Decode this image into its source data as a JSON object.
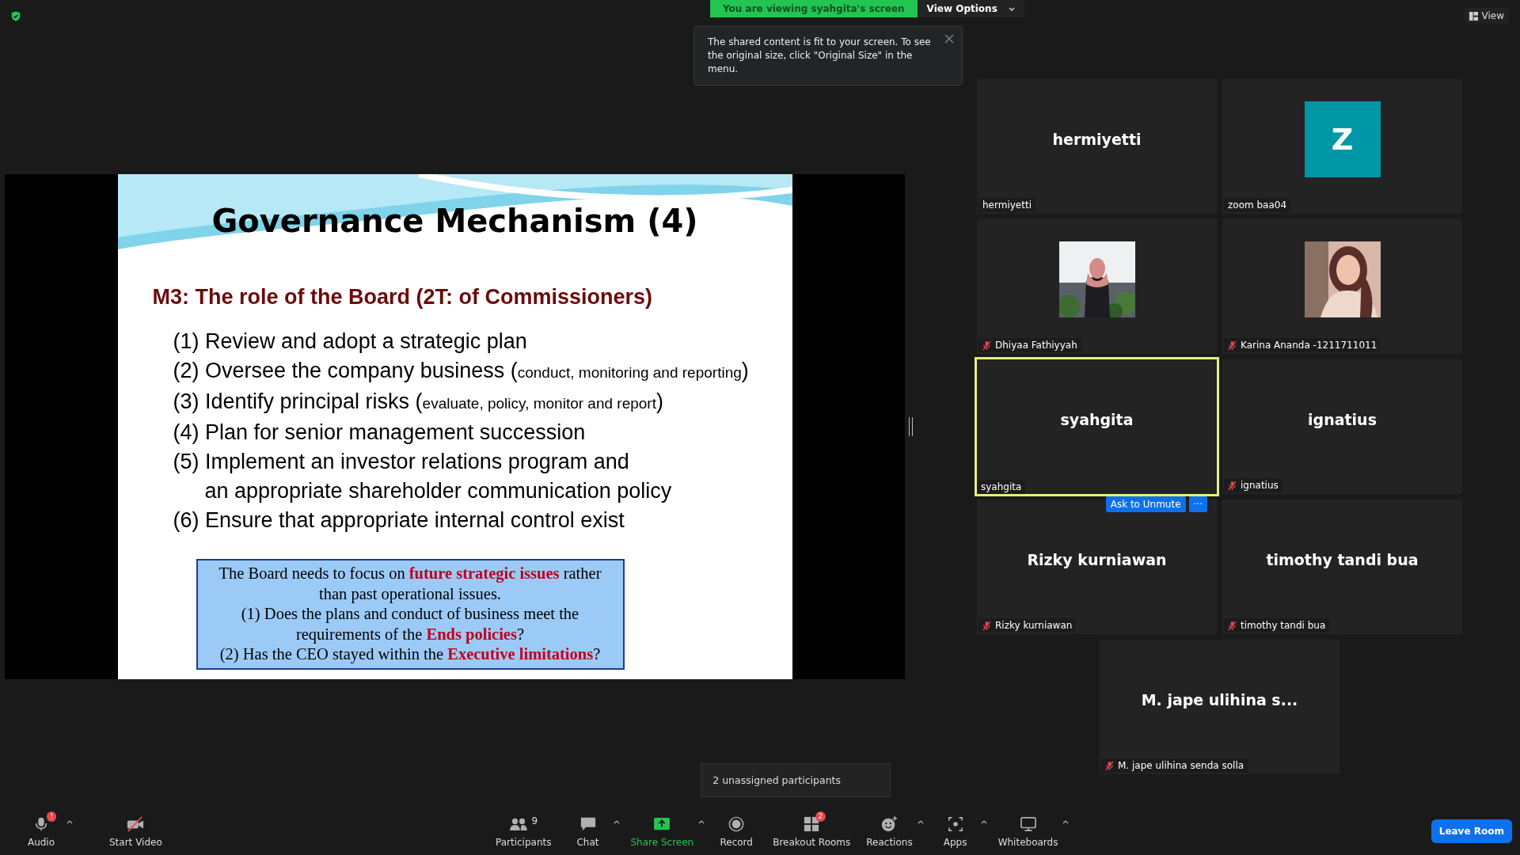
{
  "banner": {
    "text": "You are viewing syahgita's screen",
    "view_options": "View Options"
  },
  "notice": {
    "text": "The shared content is fit to your screen. To see the original size, click \"Original Size\" in the menu."
  },
  "view_button": "View",
  "slide": {
    "title": "Governance Mechanism (4)",
    "subtitle": "M3: The role of the Board (2T: of Commissioners)",
    "items": [
      {
        "main": "(1) Review and adopt a strategic plan"
      },
      {
        "main": "(2) Oversee the company business (",
        "note": "conduct, monitoring and reporting",
        "end": ")"
      },
      {
        "main": "(3) Identify principal risks (",
        "note": "evaluate, policy, monitor and report",
        "end": ")"
      },
      {
        "main": "(4) Plan for senior management succession"
      },
      {
        "main": "(5) Implement an investor relations program and"
      },
      {
        "main": "an appropriate shareholder communication policy",
        "indent": true
      },
      {
        "main": "(6) Ensure that appropriate internal control exist"
      }
    ],
    "box_lines": [
      "The Board needs to focus on **future strategic issues** rather",
      "than past operational issues.",
      "(1)  Does the plans and conduct of business meet the",
      "requirements of the **Ends  policies**?",
      "(2) Has the CEO stayed within the **Executive limitations**?"
    ]
  },
  "participants": [
    {
      "kind": "name",
      "display": "hermiyetti",
      "label": "hermiyetti",
      "muted": false,
      "selected": false
    },
    {
      "kind": "avatar",
      "display": "Z",
      "color": "#0097a7",
      "label": "zoom baa04",
      "muted": false,
      "selected": false
    },
    {
      "label": "Dhiyaa Fathiyyah",
      "muted": true,
      "selected": false
    },
    {
      "label": "Karina Ananda -1211711011",
      "muted": true,
      "selected": false
    },
    {
      "kind": "name",
      "display": "syahgita",
      "label": "syahgita",
      "muted": false,
      "selected": true
    },
    {
      "kind": "name",
      "display": "ignatius",
      "label": "ignatius",
      "muted": true,
      "selected": false
    },
    {
      "kind": "name",
      "display": "Rizky kurniawan",
      "label": "Rizky kurniawan",
      "muted": true,
      "selected": false,
      "hover_button": "Ask to Unmute",
      "more": "···"
    },
    {
      "kind": "name",
      "display": "timothy tandi bua",
      "label": "timothy tandi bua",
      "muted": true,
      "selected": false
    },
    {
      "kind": "name",
      "display": "M. jape ulihina s...",
      "label": "M. jape ulihina senda solla",
      "muted": true,
      "selected": false
    }
  ],
  "unassigned_tooltip": "2 unassigned participants",
  "toolbar": [
    {
      "kind": "mic",
      "label": "Audio",
      "badge": "!",
      "caret": true
    },
    {
      "kind": "video",
      "label": "Start Video",
      "caret": false
    },
    {
      "kind": "people",
      "label": "Participants",
      "count": "9",
      "caret": false
    },
    {
      "kind": "chat",
      "label": "Chat",
      "caret": true
    },
    {
      "kind": "share",
      "label": "Share Screen",
      "caret": true
    },
    {
      "kind": "record",
      "label": "Record",
      "caret": false
    },
    {
      "kind": "rooms",
      "label": "Breakout Rooms",
      "badge": "2",
      "caret": false
    },
    {
      "kind": "reactions",
      "label": "Reactions",
      "caret": true
    },
    {
      "kind": "apps",
      "label": "Apps",
      "caret": true
    },
    {
      "kind": "board",
      "label": "Whiteboards",
      "caret": true
    }
  ],
  "leave_button": "Leave Room"
}
